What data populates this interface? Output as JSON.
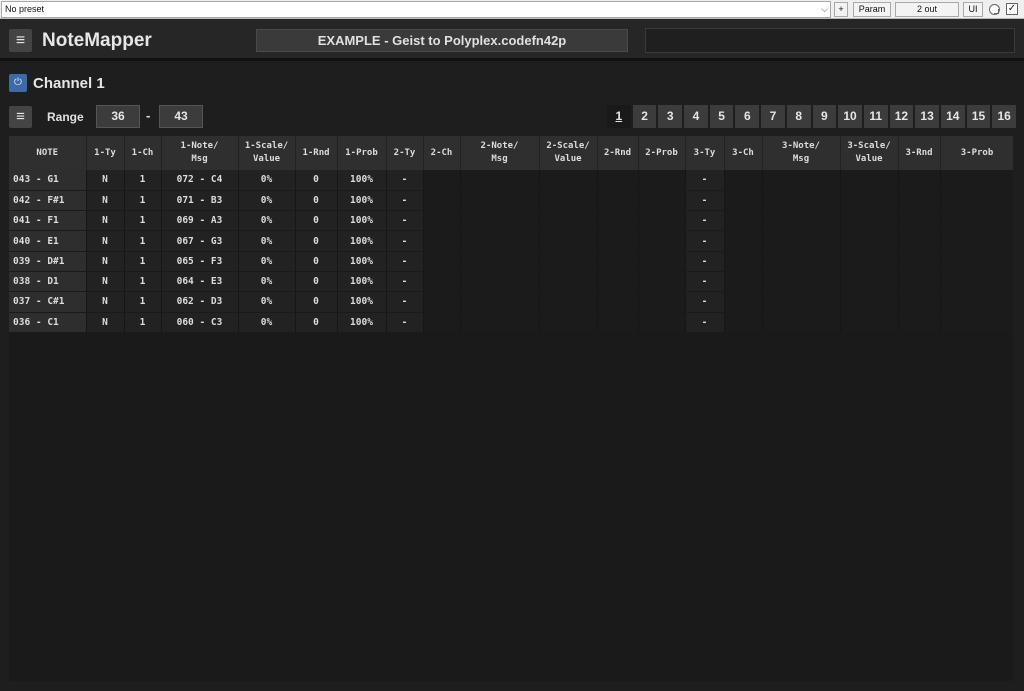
{
  "host": {
    "preset": "No preset",
    "plus": "+",
    "param": "Param",
    "out": "2 out",
    "ui": "UI",
    "checkbox": "✓"
  },
  "app": {
    "title": "NoteMapper",
    "menu_icon": "≡",
    "preset_name": "EXAMPLE - Geist to Polyplex.codefn42p"
  },
  "channel": {
    "power_icon": "⏻",
    "title": "Channel 1"
  },
  "range": {
    "label": "Range",
    "low": "36",
    "dash": "-",
    "high": "43"
  },
  "channel_tabs": [
    "1",
    "2",
    "3",
    "4",
    "5",
    "6",
    "7",
    "8",
    "9",
    "10",
    "11",
    "12",
    "13",
    "14",
    "15",
    "16"
  ],
  "active_tab": "1",
  "table": {
    "headers": [
      "NOTE",
      "1-Ty",
      "1-Ch",
      "1-Note/\nMsg",
      "1-Scale/\nValue",
      "1-Rnd",
      "1-Prob",
      "2-Ty",
      "2-Ch",
      "2-Note/\nMsg",
      "2-Scale/\nValue",
      "2-Rnd",
      "2-Prob",
      "3-Ty",
      "3-Ch",
      "3-Note/\nMsg",
      "3-Scale/\nValue",
      "3-Rnd",
      "3-Prob"
    ],
    "rows": [
      [
        "043 - G1",
        "N",
        "1",
        "072 - C4",
        "0%",
        "0",
        "100%",
        "-",
        "",
        "",
        "",
        "",
        "",
        "-",
        "",
        "",
        "",
        "",
        ""
      ],
      [
        "042 - F#1",
        "N",
        "1",
        "071 - B3",
        "0%",
        "0",
        "100%",
        "-",
        "",
        "",
        "",
        "",
        "",
        "-",
        "",
        "",
        "",
        "",
        ""
      ],
      [
        "041 - F1",
        "N",
        "1",
        "069 - A3",
        "0%",
        "0",
        "100%",
        "-",
        "",
        "",
        "",
        "",
        "",
        "-",
        "",
        "",
        "",
        "",
        ""
      ],
      [
        "040 - E1",
        "N",
        "1",
        "067 - G3",
        "0%",
        "0",
        "100%",
        "-",
        "",
        "",
        "",
        "",
        "",
        "-",
        "",
        "",
        "",
        "",
        ""
      ],
      [
        "039 - D#1",
        "N",
        "1",
        "065 - F3",
        "0%",
        "0",
        "100%",
        "-",
        "",
        "",
        "",
        "",
        "",
        "-",
        "",
        "",
        "",
        "",
        ""
      ],
      [
        "038 - D1",
        "N",
        "1",
        "064 - E3",
        "0%",
        "0",
        "100%",
        "-",
        "",
        "",
        "",
        "",
        "",
        "-",
        "",
        "",
        "",
        "",
        ""
      ],
      [
        "037 - C#1",
        "N",
        "1",
        "062 - D3",
        "0%",
        "0",
        "100%",
        "-",
        "",
        "",
        "",
        "",
        "",
        "-",
        "",
        "",
        "",
        "",
        ""
      ],
      [
        "036 - C1",
        "N",
        "1",
        "060 - C3",
        "0%",
        "0",
        "100%",
        "-",
        "",
        "",
        "",
        "",
        "",
        "-",
        "",
        "",
        "",
        "",
        ""
      ]
    ]
  }
}
